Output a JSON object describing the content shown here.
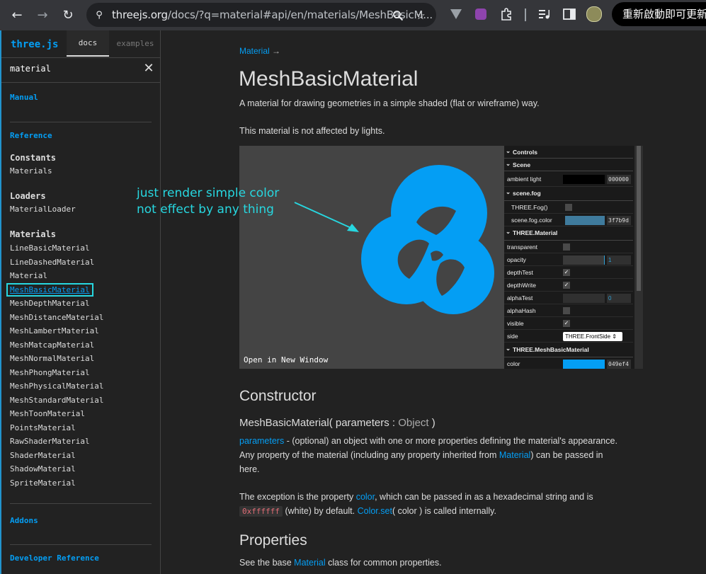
{
  "browser": {
    "back_icon": "←",
    "forward_icon": "→",
    "reload_icon": "↻",
    "site_icon": "⚲",
    "url_host": "threejs.org",
    "url_rest": "/docs/?q=material#api/en/materials/MeshBasicM...",
    "zoom_icon": "🔍",
    "star_icon": "☆",
    "restart_label": "重新啟動即可更新"
  },
  "sidebar": {
    "brand": "three.js",
    "tabs": [
      "docs",
      "examples"
    ],
    "filter_value": "material",
    "clear_icon": "✕",
    "manual": "Manual",
    "reference": "Reference",
    "constants_heading": "Constants",
    "constants_items": [
      "Materials"
    ],
    "loaders_heading": "Loaders",
    "loaders_items": [
      "MaterialLoader"
    ],
    "materials_heading": "Materials",
    "materials_items": [
      "LineBasicMaterial",
      "LineDashedMaterial",
      "Material",
      "MeshBasicMaterial",
      "MeshDepthMaterial",
      "MeshDistanceMaterial",
      "MeshLambertMaterial",
      "MeshMatcapMaterial",
      "MeshNormalMaterial",
      "MeshPhongMaterial",
      "MeshPhysicalMaterial",
      "MeshStandardMaterial",
      "MeshToonMaterial",
      "PointsMaterial",
      "RawShaderMaterial",
      "ShaderMaterial",
      "ShadowMaterial",
      "SpriteMaterial"
    ],
    "selected_item": "MeshBasicMaterial",
    "addons": "Addons",
    "developer_reference": "Developer Reference"
  },
  "main": {
    "breadcrumb_link": "Material",
    "breadcrumb_arrow": "→",
    "title": "MeshBasicMaterial",
    "description": "A material for drawing geometries in a simple shaded (flat or wireframe) way.",
    "note": "This material is not affected by lights.",
    "demo": {
      "open_window": "Open in New Window",
      "mesh_color": "#049ef4",
      "background": "#444444",
      "gui": {
        "controls": "Controls",
        "scene": "Scene",
        "ambient_light": "ambient light",
        "ambient_hex": "000000",
        "scene_fog": "scene.fog",
        "three_fog": "THREE.Fog()",
        "fog_color_label": "scene.fog.color",
        "fog_color_hex": "3f7b9d",
        "three_material": "THREE.Material",
        "transparent": "transparent",
        "opacity": "opacity",
        "opacity_value": "1",
        "depth_test": "depthTest",
        "depth_write": "depthWrite",
        "alpha_test": "alphaTest",
        "alpha_test_value": "0",
        "alpha_hash": "alphaHash",
        "visible": "visible",
        "side": "side",
        "side_value": "THREE.FrontSide ⇕",
        "mesh_basic": "THREE.MeshBasicMaterial",
        "color": "color",
        "color_hex": "049ef4",
        "check": "✓",
        "collapse_icon": "⌄"
      }
    },
    "annotation_line1": "just render simple color",
    "annotation_line2": "not effect by any thing",
    "constructor_heading": "Constructor",
    "constructor_sig_name": "MeshBasicMaterial( parameters :",
    "constructor_sig_type": "Object",
    "constructor_sig_end": ")",
    "param_link": "parameters",
    "param_text_1": " - (optional) an object with one or more properties defining the material's appearance.",
    "param_text_2a": "Any property of the material (including any property inherited from ",
    "param_text_2_link": "Material",
    "param_text_2b": ") can be passed in",
    "param_text_3": "here.",
    "exception_a": "The exception is the property ",
    "exception_link": "color",
    "exception_b": ", which can be passed in as a hexadecimal string and is",
    "exception_code": "0xffffff",
    "exception_c": " (white) by default. ",
    "exception_link2": "Color.set",
    "exception_d": "( color ) is called internally.",
    "properties_heading": "Properties",
    "properties_a": "See the base ",
    "properties_link": "Material",
    "properties_b": " class for common properties."
  }
}
